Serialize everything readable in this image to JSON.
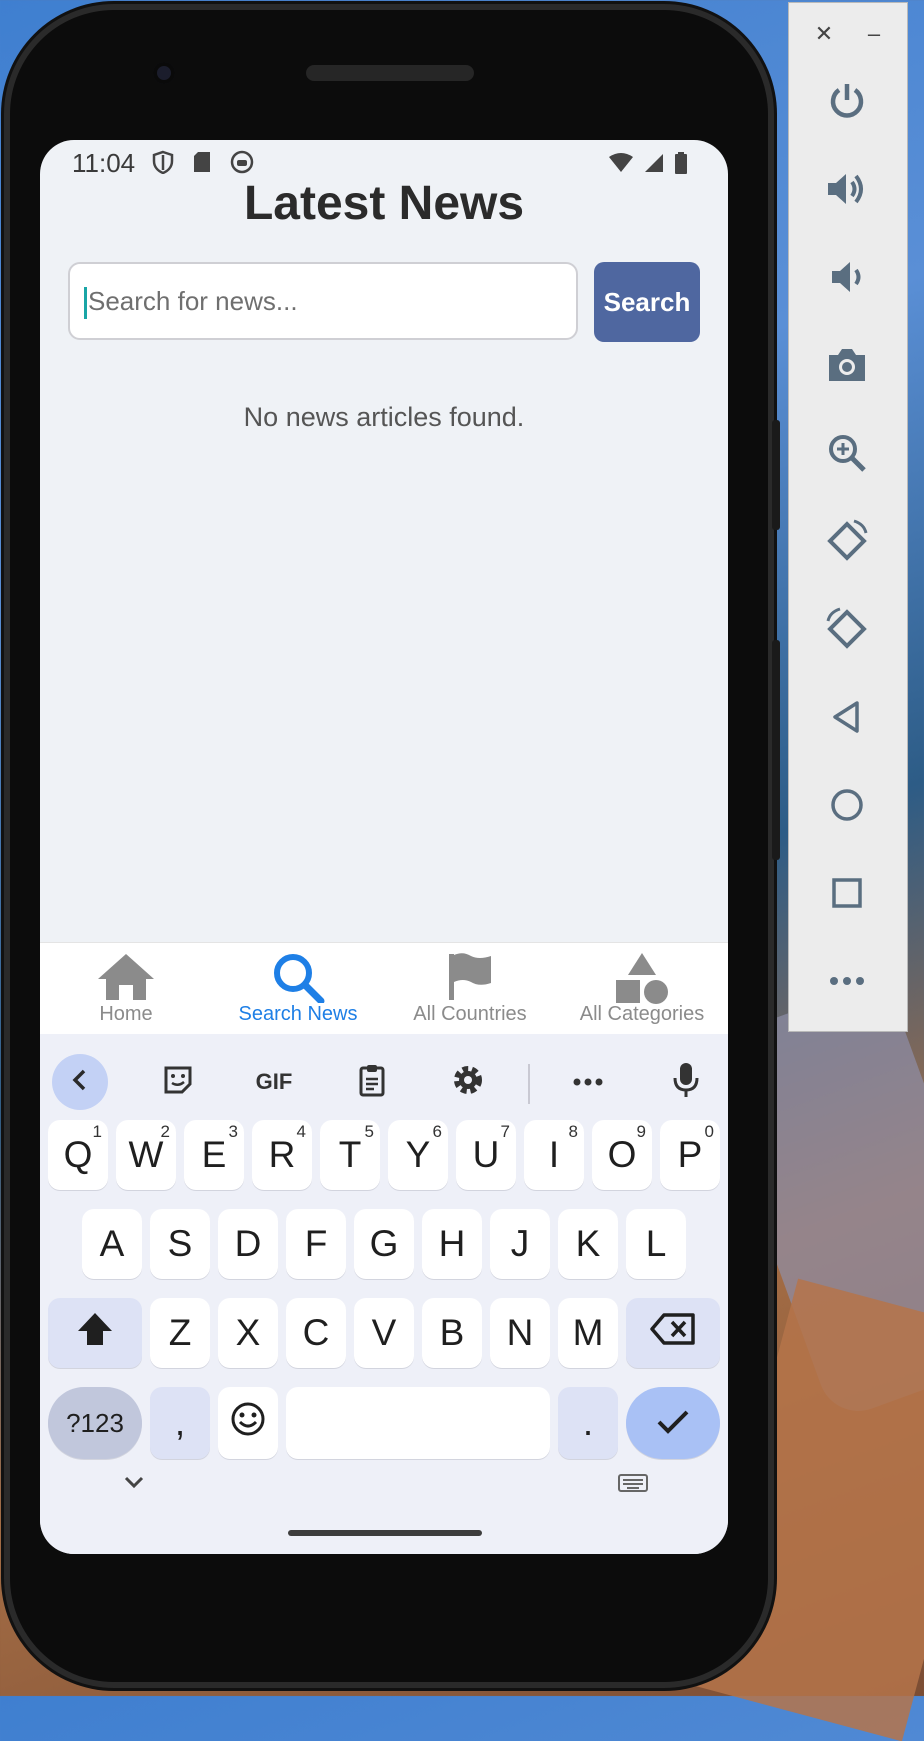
{
  "status_bar": {
    "time": "11:04"
  },
  "app": {
    "title": "Latest News",
    "search": {
      "placeholder": "Search for news...",
      "value": "",
      "button_label": "Search"
    },
    "empty_message": "No news articles found."
  },
  "bottom_nav": {
    "items": [
      {
        "label": "Home",
        "icon": "home-icon",
        "active": false
      },
      {
        "label": "Search News",
        "icon": "search-icon",
        "active": true
      },
      {
        "label": "All Countries",
        "icon": "flag-icon",
        "active": false
      },
      {
        "label": "All Categories",
        "icon": "shapes-icon",
        "active": false
      }
    ],
    "active_color": "#1e7fe6",
    "inactive_color": "#8b8b8b"
  },
  "keyboard": {
    "toolbar": [
      "back-icon",
      "sticker-icon",
      "GIF",
      "clipboard-icon",
      "gear-icon",
      "more-icon",
      "mic-icon"
    ],
    "gif_label": "GIF",
    "row1": [
      {
        "k": "Q",
        "h": "1"
      },
      {
        "k": "W",
        "h": "2"
      },
      {
        "k": "E",
        "h": "3"
      },
      {
        "k": "R",
        "h": "4"
      },
      {
        "k": "T",
        "h": "5"
      },
      {
        "k": "Y",
        "h": "6"
      },
      {
        "k": "U",
        "h": "7"
      },
      {
        "k": "I",
        "h": "8"
      },
      {
        "k": "O",
        "h": "9"
      },
      {
        "k": "P",
        "h": "0"
      }
    ],
    "row2": [
      "A",
      "S",
      "D",
      "F",
      "G",
      "H",
      "J",
      "K",
      "L"
    ],
    "row3": [
      "Z",
      "X",
      "C",
      "V",
      "B",
      "N",
      "M"
    ],
    "symbols_label": "?123",
    "comma": ",",
    "period": "."
  },
  "emulator_toolbar": {
    "controls": [
      "close-icon",
      "minimize-icon"
    ],
    "close_glyph": "✕",
    "minimize_glyph": "–",
    "buttons": [
      "power-icon",
      "volume-up-icon",
      "volume-down-icon",
      "camera-icon",
      "zoom-icon",
      "rotate-left-icon",
      "rotate-right-icon",
      "back-icon",
      "home-icon",
      "overview-icon",
      "more-icon"
    ]
  },
  "colors": {
    "primary_button": "#4f67a0",
    "screen_bg": "#eff2f6",
    "keyboard_bg": "#eef0f8",
    "enter_key": "#a9c1f5"
  }
}
